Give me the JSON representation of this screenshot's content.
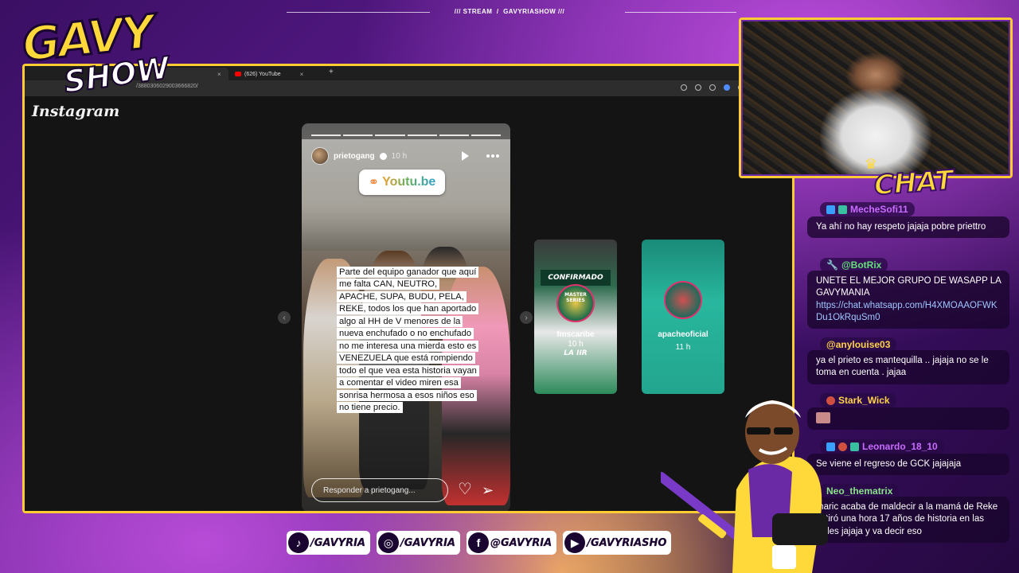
{
  "overlay": {
    "top_label_stream": "STREAM",
    "top_label_show": "GAVYRIASHOW",
    "logo_line1": "GAVY",
    "logo_line2": "SHOW",
    "chat_title": "CHAT"
  },
  "browser": {
    "tab_youtube": "(626) YouTube",
    "url": "/3880306029003666820/"
  },
  "instagram": {
    "logo": "Instagram",
    "story": {
      "username": "prietogang",
      "time": "10 h",
      "link_sticker": "Youtu.be",
      "text": "Parte del equipo ganador que aquí me falta CAN, NEUTRO, APACHE, SUPA, BUDU, PELA, REKE, todos los que han aportado algo al HH de V menores de la nueva enchufado o no enchufado no me interesa una mierda esto es VENEZUELA que está rompiendo todo el que vea esta historia vayan a comentar el video miren esa sonrisa hermosa a esos niños eso no tiene precio.",
      "reply_placeholder": "Responder a prietogang..."
    },
    "thumbs": [
      {
        "username": "fmscaribe",
        "time": "10 h",
        "banner_top": "CONFIRMADO",
        "banner_mid": "MASTER SERIES",
        "banner_bottom": "LA IIR"
      },
      {
        "username": "apacheoficial",
        "time": "11 h"
      }
    ]
  },
  "chat": {
    "messages": [
      {
        "user": "MecheSofi11",
        "color": "#c86bff",
        "text": "Ya ahí no hay respeto jajaja pobre priettro"
      },
      {
        "user": "@BotRix",
        "color": "#63e07a",
        "text": "UNETE EL MEJOR GRUPO DE WASAPP LA GAVYMANIA",
        "link": "https://chat.whatsapp.com/H4XMOAAOFWKDu1OkRquSm0"
      },
      {
        "user": "@anylouise03",
        "color": "#ffd24a",
        "text": "ya el prieto es mantequilla .. jajaja no se le toma en cuenta . jajaa"
      },
      {
        "user": "Stark_Wick",
        "color": "#ffd24a",
        "text": ""
      },
      {
        "user": "Leonardo_18_10",
        "color": "#c86bff",
        "text": "Se viene el regreso de GCK jajajaja"
      },
      {
        "user": "Neo_thematrix",
        "color": "#8be28b",
        "text": "maric acaba de maldecir a la mamá de Reke le tiró una hora 17 años de historia en las redes jajaja y va decir eso"
      }
    ]
  },
  "socials": [
    {
      "icon": "tiktok-icon",
      "glyph": "♪",
      "handle": "/GAVYRIA"
    },
    {
      "icon": "instagram-icon",
      "glyph": "◎",
      "handle": "/GAVYRIA"
    },
    {
      "icon": "facebook-icon",
      "glyph": "f",
      "handle": "@GAVYRIA"
    },
    {
      "icon": "youtube-icon",
      "glyph": "▶",
      "handle": "/GAVYRIASHO"
    }
  ],
  "colors": {
    "accent_yellow": "#ffcc33",
    "purple": "#5a1b8c"
  }
}
